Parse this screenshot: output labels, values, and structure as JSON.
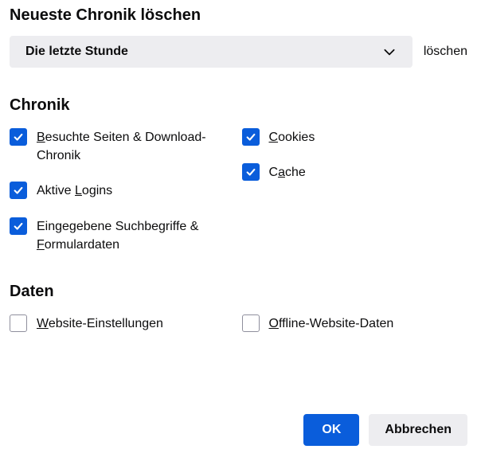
{
  "title": "Neueste Chronik löschen",
  "time_range": {
    "selected": "Die letzte Stunde",
    "suffix": "löschen"
  },
  "sections": {
    "history": {
      "heading": "Chronik",
      "left": [
        {
          "label_pre": "",
          "label_u": "B",
          "label_post": "esuchte Seiten & Download-Chronik",
          "checked": true,
          "name": "visited-downloads"
        },
        {
          "label_pre": "Aktive ",
          "label_u": "L",
          "label_post": "ogins",
          "checked": true,
          "name": "active-logins"
        },
        {
          "label_pre": "Eingegebene Suchbegriffe & ",
          "label_u": "F",
          "label_post": "ormulardaten",
          "checked": true,
          "name": "search-form-data"
        }
      ],
      "right": [
        {
          "label_pre": "",
          "label_u": "C",
          "label_post": "ookies",
          "checked": true,
          "name": "cookies"
        },
        {
          "label_pre": "C",
          "label_u": "a",
          "label_post": "che",
          "checked": true,
          "name": "cache"
        }
      ]
    },
    "data": {
      "heading": "Daten",
      "left": [
        {
          "label_pre": "",
          "label_u": "W",
          "label_post": "ebsite-Einstellungen",
          "checked": false,
          "name": "site-settings"
        }
      ],
      "right": [
        {
          "label_pre": "",
          "label_u": "O",
          "label_post": "ffline-Website-Daten",
          "checked": false,
          "name": "offline-data"
        }
      ]
    }
  },
  "buttons": {
    "ok": "OK",
    "cancel": "Abbrechen"
  }
}
